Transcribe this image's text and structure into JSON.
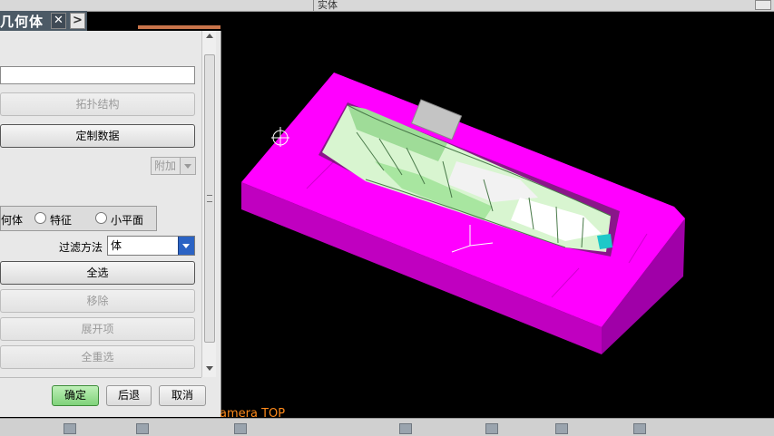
{
  "topbar": {
    "label": "实体"
  },
  "dialog": {
    "title": "几何体",
    "close_glyph": "✕",
    "arrow_glyph": ">",
    "buttons": {
      "topology": "拓扑结构",
      "custom_data": "定制数据",
      "select_all": "全选",
      "remove": "移除",
      "expand": "展开项",
      "reselect_all": "全重选",
      "ok": "确定",
      "back": "后退",
      "cancel": "取消"
    },
    "append_select": {
      "value": "附加"
    },
    "radio_options": [
      "何体",
      "特征",
      "小平面"
    ],
    "filter": {
      "label": "过滤方法",
      "value": "体"
    }
  },
  "viewport": {
    "camera_label": "amera TOP"
  },
  "colors": {
    "mold_base": "#ff00ff",
    "part": "#c8f0c0",
    "cursor": "#ffffff",
    "label": "#ff8a1a"
  }
}
